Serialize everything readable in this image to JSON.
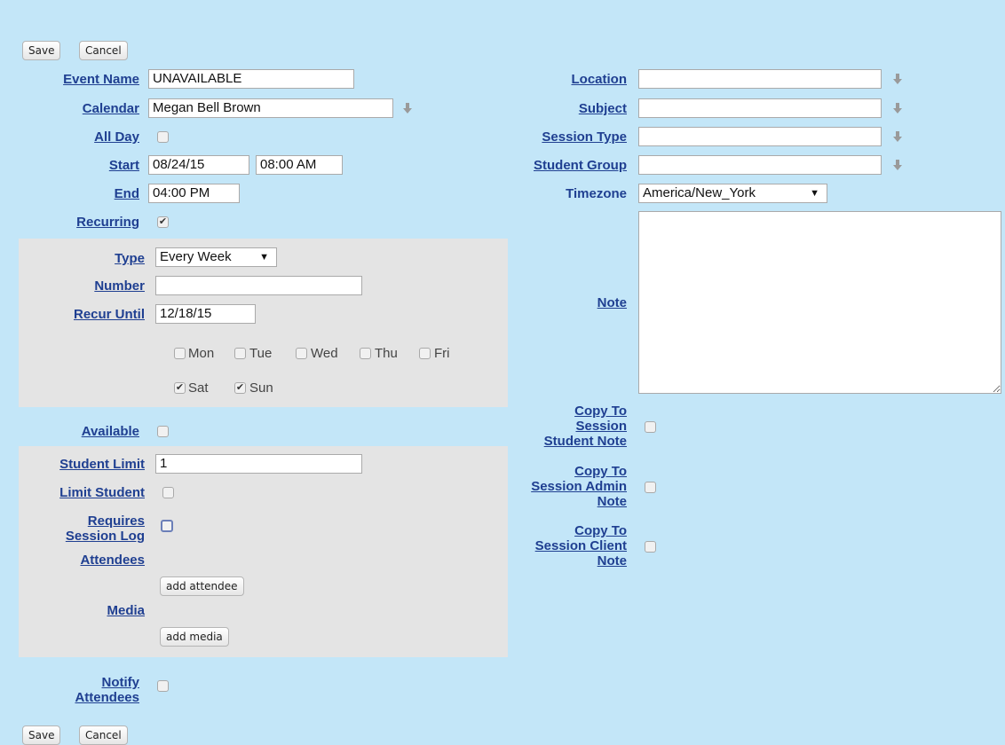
{
  "toolbar": {
    "save_label": "Save",
    "cancel_label": "Cancel"
  },
  "form": {
    "event_name": {
      "label": "Event Name",
      "value": "UNAVAILABLE"
    },
    "calendar": {
      "label": "Calendar",
      "value": "Megan Bell Brown"
    },
    "all_day": {
      "label": "All Day",
      "checked": false
    },
    "start": {
      "label": "Start",
      "date": "08/24/15",
      "time": "08:00 AM"
    },
    "end": {
      "label": "End",
      "time": "04:00 PM"
    },
    "recurring": {
      "label": "Recurring",
      "checked": true
    },
    "recurrence": {
      "type": {
        "label": "Type",
        "value": "Every Week"
      },
      "number": {
        "label": "Number",
        "value": ""
      },
      "recur_until": {
        "label": "Recur Until",
        "value": "12/18/15"
      },
      "days": [
        {
          "name": "Mon",
          "checked": false
        },
        {
          "name": "Tue",
          "checked": false
        },
        {
          "name": "Wed",
          "checked": false
        },
        {
          "name": "Thu",
          "checked": false
        },
        {
          "name": "Fri",
          "checked": false
        },
        {
          "name": "Sat",
          "checked": true
        },
        {
          "name": "Sun",
          "checked": true
        }
      ]
    },
    "available": {
      "label": "Available",
      "checked": false
    },
    "student_limit": {
      "label": "Student Limit",
      "value": "1"
    },
    "limit_student": {
      "label": "Limit Student",
      "checked": false
    },
    "requires_session_log": {
      "label_line1": "Requires",
      "label_line2": "Session Log",
      "checked": false
    },
    "attendees": {
      "label": "Attendees",
      "button": "add attendee"
    },
    "media": {
      "label": "Media",
      "button": "add media"
    },
    "notify_attendees": {
      "label_line1": "Notify",
      "label_line2": "Attendees",
      "checked": false
    },
    "location": {
      "label": "Location",
      "value": ""
    },
    "subject": {
      "label": "Subject",
      "value": ""
    },
    "session_type": {
      "label": "Session Type",
      "value": ""
    },
    "student_group": {
      "label": "Student Group",
      "value": ""
    },
    "timezone": {
      "label": "Timezone",
      "value": "America/New_York"
    },
    "note": {
      "label": "Note",
      "value": ""
    },
    "copy_student_note": {
      "line1": "Copy To",
      "line2": "Session",
      "line3": "Student Note",
      "checked": false
    },
    "copy_admin_note": {
      "line1": "Copy To",
      "line2": "Session Admin",
      "line3": "Note",
      "checked": false
    },
    "copy_client_note": {
      "line1": "Copy To",
      "line2": "Session Client",
      "line3": "Note",
      "checked": false
    }
  },
  "icons": {
    "dropdown": "down-arrow-icon",
    "check": "checkmark-icon"
  },
  "colors": {
    "background": "#c3e6f8",
    "panel": "#e4e4e4",
    "label": "#1f3f91"
  }
}
